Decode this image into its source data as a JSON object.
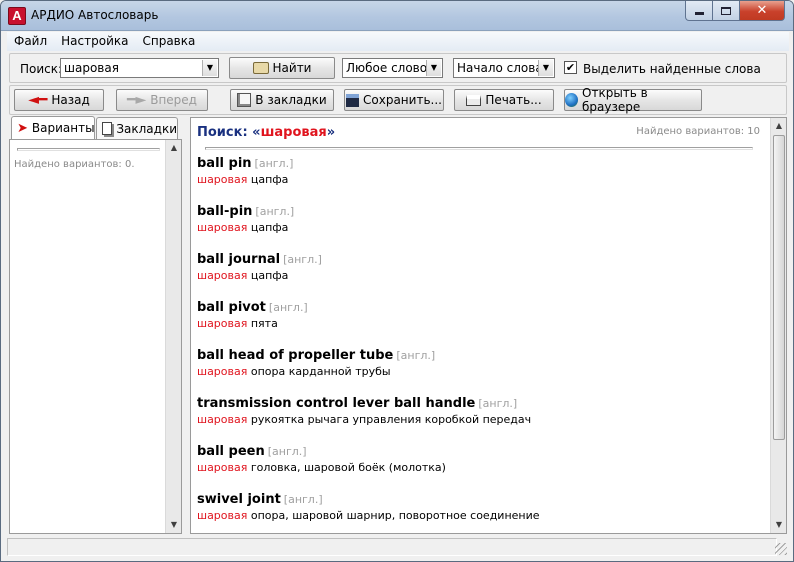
{
  "window": {
    "title": "АРДИО Автословарь",
    "app_icon_letter": "A"
  },
  "menu": [
    "Файл",
    "Настройка",
    "Справка"
  ],
  "search": {
    "label": "Поиск:",
    "value": "шаровая",
    "find_button": "Найти",
    "word_mode": "Любое слово",
    "position_mode": "Начало слова",
    "highlight_checked": true,
    "highlight_label": "Выделить найденные слова"
  },
  "nav": {
    "back": "Назад",
    "forward": "Вперед",
    "bookmark": "В закладки",
    "save": "Сохранить...",
    "print": "Печать...",
    "browser": "Открыть в браузере"
  },
  "left": {
    "tab_variants": "Варианты",
    "tab_bookmarks": "Закладки",
    "status": "Найдено вариантов: 0."
  },
  "results": {
    "heading_prefix": "Поиск: «",
    "query": "шаровая",
    "heading_suffix": "»",
    "found": "Найдено вариантов: 10",
    "entries": [
      {
        "term": "ball pin",
        "lang": "[англ.]",
        "hl": "шаровая",
        "rest": " цапфа"
      },
      {
        "term": "ball-pin",
        "lang": "[англ.]",
        "hl": "шаровая",
        "rest": " цапфа"
      },
      {
        "term": "ball journal",
        "lang": "[англ.]",
        "hl": "шаровая",
        "rest": " цапфа"
      },
      {
        "term": "ball pivot",
        "lang": "[англ.]",
        "hl": "шаровая",
        "rest": " пята"
      },
      {
        "term": "ball head of propeller tube",
        "lang": "[англ.]",
        "hl": "шаровая",
        "rest": " опора карданной трубы"
      },
      {
        "term": "transmission control lever ball handle",
        "lang": "[англ.]",
        "hl": "шаровая",
        "rest": " рукоятка рычага управления коробкой передач"
      },
      {
        "term": "ball peen",
        "lang": "[англ.]",
        "hl": "шаровая",
        "rest": " головка, шаровой боёк (молотка)"
      },
      {
        "term": "swivel joint",
        "lang": "[англ.]",
        "hl": "шаровая",
        "rest": " опора, шаровой шарнир, поворотное соединение"
      }
    ]
  },
  "colors": {
    "highlight": "#e0141e",
    "heading": "#1a3180",
    "muted": "#8a8a8a"
  },
  "icons": [
    "app-icon",
    "minimize-icon",
    "maximize-icon",
    "close-icon",
    "dropdown-arrow-icon",
    "search-hand-icon",
    "back-arrow-icon",
    "forward-arrow-icon",
    "bookmark-icon",
    "save-disk-icon",
    "printer-icon",
    "globe-icon",
    "variants-arrow-icon",
    "bookmarks-pages-icon",
    "checkmark-icon",
    "resize-grip-icon"
  ]
}
